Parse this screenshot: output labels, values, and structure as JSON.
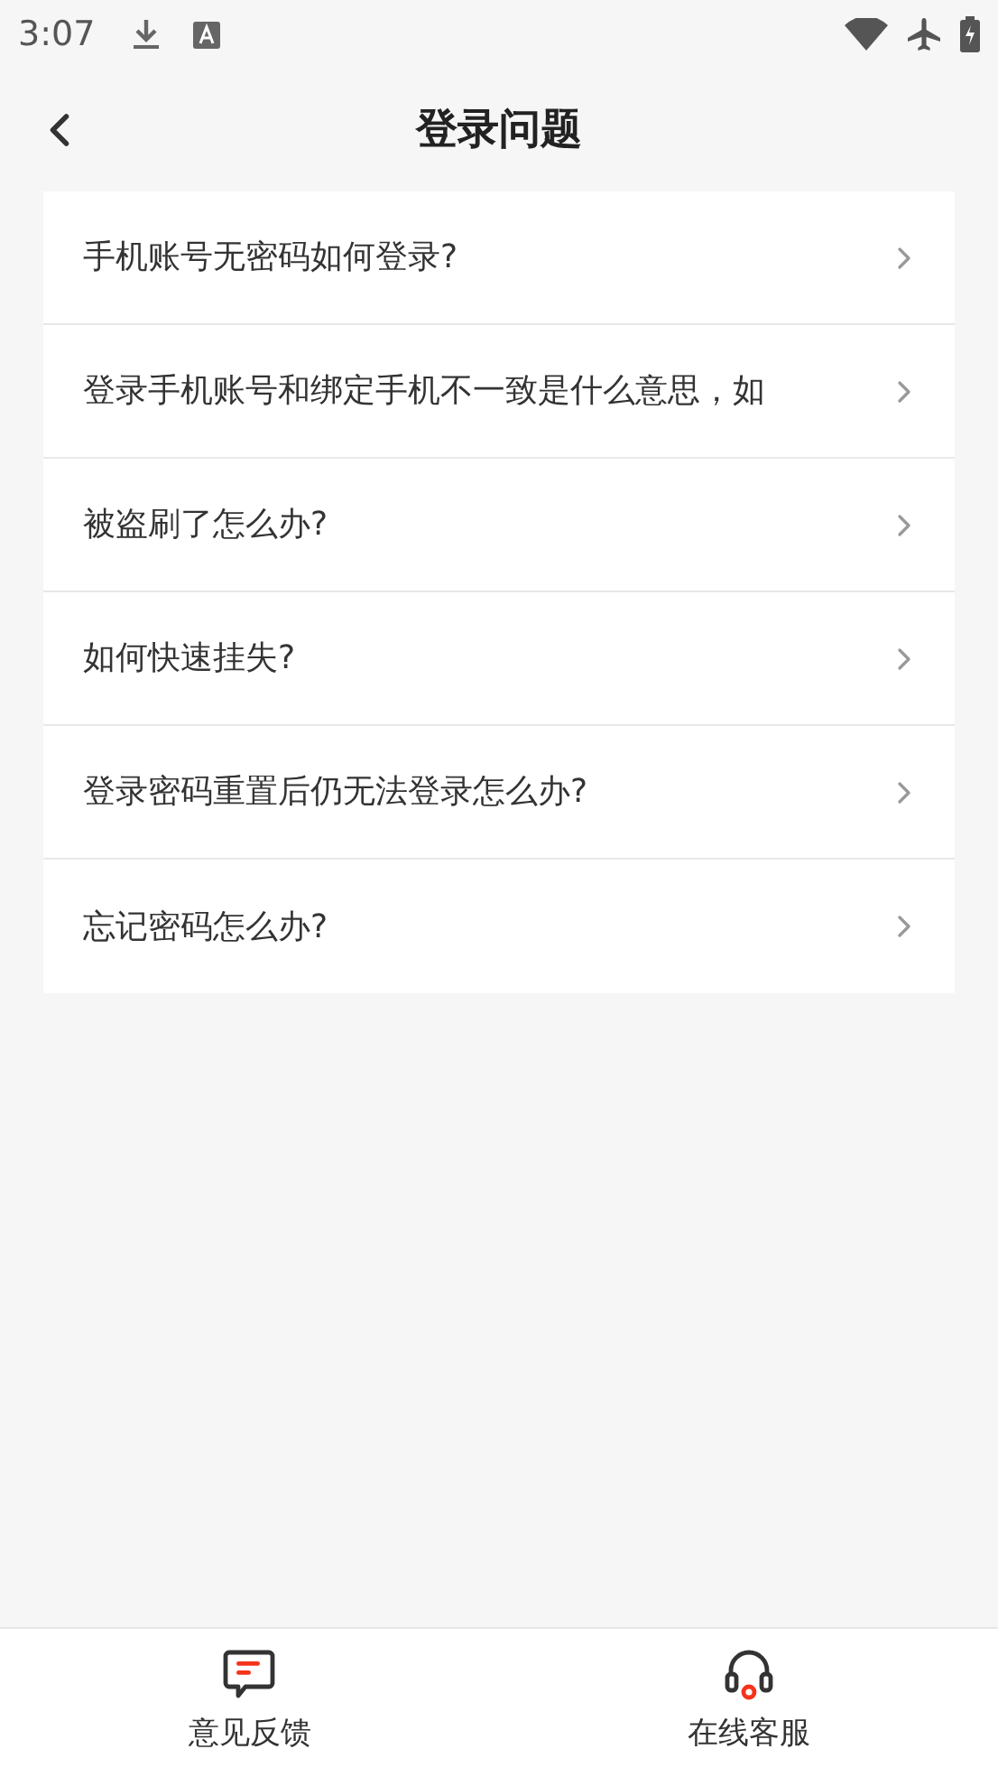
{
  "status_bar": {
    "time": "3:07"
  },
  "header": {
    "title": "登录问题"
  },
  "questions": [
    {
      "text": "手机账号无密码如何登录?"
    },
    {
      "text": "登录手机账号和绑定手机不一致是什么意思，如"
    },
    {
      "text": "被盗刷了怎么办?"
    },
    {
      "text": "如何快速挂失?"
    },
    {
      "text": "登录密码重置后仍无法登录怎么办?"
    },
    {
      "text": "忘记密码怎么办?"
    }
  ],
  "bottom_bar": [
    {
      "kind": "feedback",
      "label": "意见反馈"
    },
    {
      "kind": "service",
      "label": "在线客服"
    }
  ]
}
